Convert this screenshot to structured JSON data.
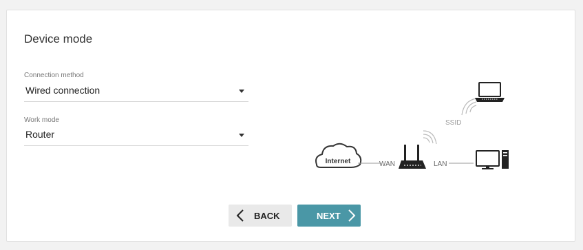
{
  "page": {
    "title": "Device mode"
  },
  "connection_method": {
    "label": "Connection method",
    "value": "Wired connection"
  },
  "work_mode": {
    "label": "Work mode",
    "value": "Router"
  },
  "diagram": {
    "internet": "Internet",
    "wan": "WAN",
    "lan": "LAN",
    "ssid": "SSID"
  },
  "buttons": {
    "back": "BACK",
    "next": "NEXT"
  },
  "colors": {
    "accent": "#4a97a6",
    "back_button": "#e9e9e9"
  }
}
